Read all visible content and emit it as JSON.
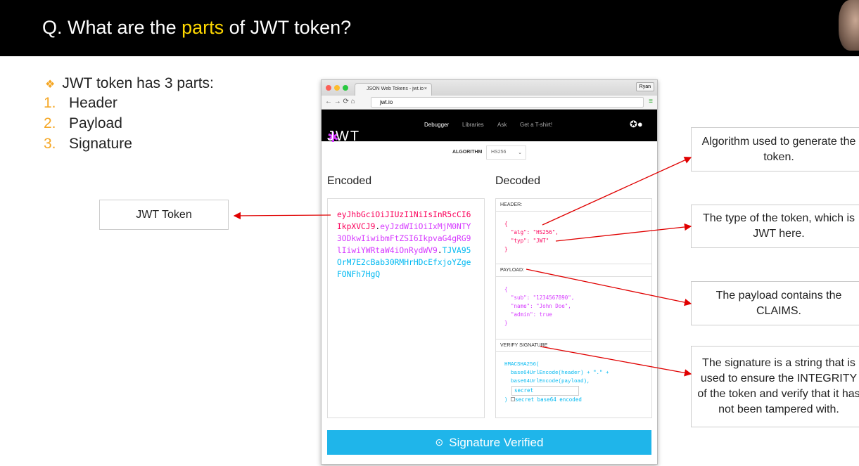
{
  "slide": {
    "title_pre": "Q. What are the ",
    "title_highlight": "parts",
    "title_post": " of JWT token?",
    "intro": "JWT token has 3 parts:",
    "parts": [
      {
        "num": "1.",
        "label": "Header"
      },
      {
        "num": "2.",
        "label": "Payload"
      },
      {
        "num": "3.",
        "label": "Signature"
      }
    ],
    "jwt_token_label": "JWT Token",
    "callouts": [
      "Algorithm used to generate the token.",
      "The type of the token, which is JWT here.",
      "The payload contains the CLAIMS.",
      "The signature is a string that is used to ensure the INTEGRITY of the token and verify that it has not been tampered with."
    ]
  },
  "browser": {
    "tab_title": "JSON Web Tokens - jwt.io",
    "user": "Ryan",
    "url": "jwt.io",
    "nav": {
      "logo": "JWT",
      "items": [
        "Debugger",
        "Libraries",
        "Ask",
        "Get a T-shirt!"
      ]
    },
    "algorithm_label": "ALGORITHM",
    "algorithm_value": "HS256",
    "encoded_title": "Encoded",
    "decoded_title": "Decoded",
    "token_header": "eyJhbGciOiJIUzI1NiIsInR5cCI6IkpXVCJ9",
    "token_payload": "eyJzdWIiOiIxMjM0NTY3ODkwIiwibmFtZSI6IkpvaG4gRG9lIiwiYWRtaW4iOnRydWV9",
    "token_signature": "TJVA95OrM7E2cBab30RMHrHDcEfxjoYZgeFONFh7HgQ",
    "header_label": "HEADER:",
    "header_json": "{\n  \"alg\": \"HS256\",\n  \"typ\": \"JWT\"\n}",
    "payload_label": "PAYLOAD:",
    "payload_json": "{\n  \"sub\": \"1234567890\",\n  \"name\": \"John Doe\",\n  \"admin\": true\n}",
    "verify_label": "VERIFY SIGNATURE",
    "verify_code": "HMACSHA256(\n  base64UrlEncode(header) + \".\" +\n  base64UrlEncode(payload),",
    "secret_value": "secret",
    "verify_close": ")",
    "base64_label": "secret base64 encoded",
    "verified_label": "Signature Verified"
  },
  "colors": {
    "highlight": "#ffd800",
    "bullet": "#f5a623",
    "header": "#fb015b",
    "payload": "#d63aff",
    "signature": "#00b9f1",
    "button": "#1fb5ea",
    "arrow": "#e00000"
  }
}
